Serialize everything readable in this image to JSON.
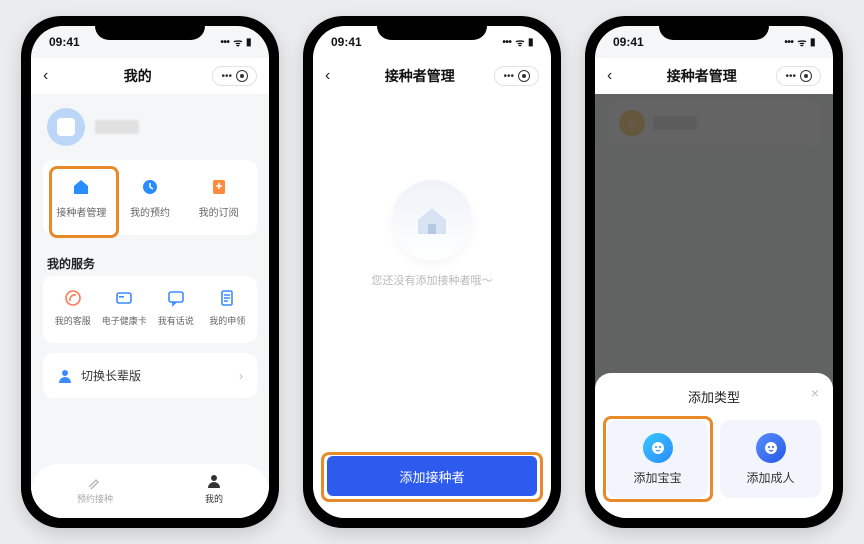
{
  "status": {
    "time": "09:41",
    "signal": "􀙇",
    "wifi": "􀙈",
    "battery": "􀛨"
  },
  "header_actions": {
    "more": "•••"
  },
  "phone1": {
    "title": "我的",
    "tiles": [
      {
        "label": "接种者管理",
        "icon": "house-icon"
      },
      {
        "label": "我的预约",
        "icon": "clock-icon"
      },
      {
        "label": "我的订阅",
        "icon": "bell-icon"
      }
    ],
    "services_title": "我的服务",
    "services": [
      {
        "label": "我的客服",
        "icon": "chat-icon"
      },
      {
        "label": "电子健康卡",
        "icon": "card-icon"
      },
      {
        "label": "我有话说",
        "icon": "msg-icon"
      },
      {
        "label": "我的申领",
        "icon": "doc-icon"
      }
    ],
    "switch_label": "切换长辈版",
    "tabs": [
      {
        "label": "预约接种"
      },
      {
        "label": "我的"
      }
    ]
  },
  "phone2": {
    "title": "接种者管理",
    "empty_text": "您还没有添加接种者哦～",
    "button": "添加接种者"
  },
  "phone3": {
    "title": "接种者管理",
    "sheet_title": "添加类型",
    "options": [
      {
        "label": "添加宝宝"
      },
      {
        "label": "添加成人"
      }
    ]
  }
}
